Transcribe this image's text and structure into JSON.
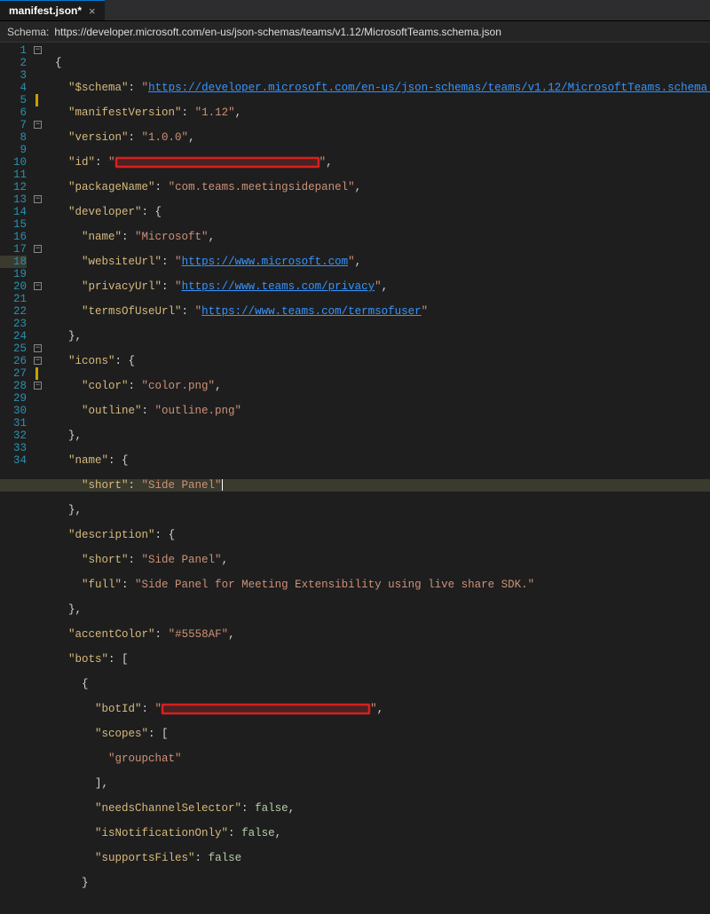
{
  "tab": {
    "title": "manifest.json*",
    "close": "×"
  },
  "schema": {
    "label": "Schema:",
    "url": "https://developer.microsoft.com/en-us/json-schemas/teams/v1.12/MicrosoftTeams.schema.json"
  },
  "lines": {
    "l1": "1",
    "l2": "2",
    "l3": "3",
    "l4": "4",
    "l5": "5",
    "l6": "6",
    "l7": "7",
    "l8": "8",
    "l9": "9",
    "l10": "10",
    "l11": "11",
    "l12": "12",
    "l13": "13",
    "l14": "14",
    "l15": "15",
    "l16": "16",
    "l17": "17",
    "l18": "18",
    "l19": "19",
    "l20": "20",
    "l21": "21",
    "l22": "22",
    "l23": "23",
    "l24": "24",
    "l25": "25",
    "l26": "26",
    "l27": "27",
    "l28": "28",
    "l29": "29",
    "l30": "30",
    "l31": "31",
    "l32": "32",
    "l33": "33",
    "l34": "34"
  },
  "json": {
    "schemaKey": "\"$schema\"",
    "schemaVal": "https://developer.microsoft.com/en-us/json-schemas/teams/v1.12/MicrosoftTeams.schema.json",
    "manifestVersionKey": "\"manifestVersion\"",
    "manifestVersionVal": "\"1.12\"",
    "versionKey": "\"version\"",
    "versionVal": "\"1.0.0\"",
    "idKey": "\"id\"",
    "packageNameKey": "\"packageName\"",
    "packageNameVal": "\"com.teams.meetingsidepanel\"",
    "developerKey": "\"developer\"",
    "devNameKey": "\"name\"",
    "devNameVal": "\"Microsoft\"",
    "websiteKey": "\"websiteUrl\"",
    "websiteVal": "https://www.microsoft.com",
    "privacyKey": "\"privacyUrl\"",
    "privacyVal": "https://www.teams.com/privacy",
    "termsKey": "\"termsOfUseUrl\"",
    "termsVal": "https://www.teams.com/termsofuser",
    "iconsKey": "\"icons\"",
    "colorKey": "\"color\"",
    "colorVal": "\"color.png\"",
    "outlineKey": "\"outline\"",
    "outlineVal": "\"outline.png\"",
    "nameKey": "\"name\"",
    "shortKey": "\"short\"",
    "shortVal": "\"Side Panel\"",
    "descKey": "\"description\"",
    "descShortVal": "\"Side Panel\"",
    "fullKey": "\"full\"",
    "fullVal": "\"Side Panel for Meeting Extensibility using live share SDK.\"",
    "accentKey": "\"accentColor\"",
    "accentVal": "\"#5558AF\"",
    "botsKey": "\"bots\"",
    "botIdKey": "\"botId\"",
    "scopesKey": "\"scopes\"",
    "groupchat": "\"groupchat\"",
    "needsChannelKey": "\"needsChannelSelector\"",
    "isNotifKey": "\"isNotificationOnly\"",
    "supportsFilesKey": "\"supportsFiles\"",
    "falseVal": "false",
    "q": "\"",
    "colon": ": ",
    "comma": ",",
    "obrace": "{",
    "cbrace": "}",
    "obracket": "[",
    "cbracket": "]"
  }
}
